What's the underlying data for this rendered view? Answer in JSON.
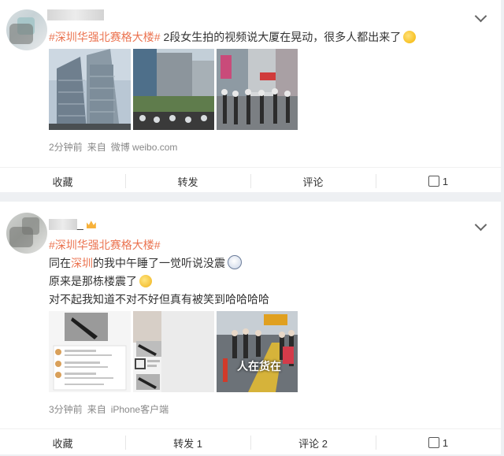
{
  "posts": [
    {
      "name": "",
      "hashtag": "#深圳华强北赛格大楼#",
      "text": " 2段女生拍的视频说大厦在晃动，很多人都出来了",
      "emoji": "smirk-emoji",
      "meta": {
        "time": "2分钟前",
        "from": "来自",
        "source": "微博 weibo.com"
      },
      "actions": {
        "favorite": "收藏",
        "repost": "转发",
        "comment": "评论",
        "like": "1"
      }
    },
    {
      "name": "_",
      "hashtag": "#深圳华强北赛格大楼#",
      "lines": [
        {
          "prefix": "同在",
          "link": "深圳",
          "suffix": "的我中午睡了一觉听说没震",
          "emoji": "ghost-emoji"
        },
        {
          "prefix": "原来是那栋楼震了",
          "emoji": "laugh-cry-emoji"
        },
        {
          "prefix": "对不起我知道不对不好但真有被笑到哈哈哈哈"
        }
      ],
      "image_caption": "人在货在",
      "meta": {
        "time": "3分钟前",
        "from": "来自",
        "source": "iPhone客户端"
      },
      "actions": {
        "favorite": "收藏",
        "repost": "转发 1",
        "comment": "评论 2",
        "like": "1"
      }
    }
  ]
}
